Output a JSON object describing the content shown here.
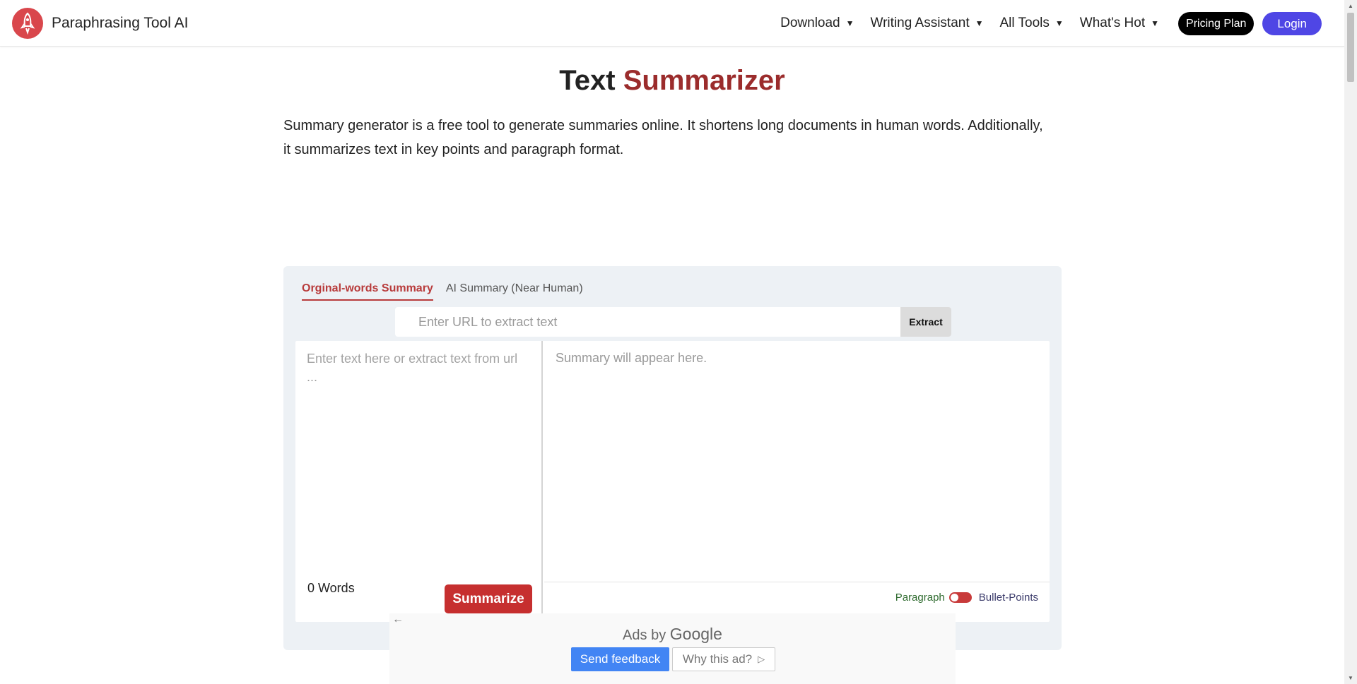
{
  "brand": {
    "name": "Paraphrasing Tool AI"
  },
  "nav": {
    "items": [
      {
        "label": "Download"
      },
      {
        "label": "Writing Assistant"
      },
      {
        "label": "All Tools"
      },
      {
        "label": "What's Hot"
      }
    ],
    "pricing_label": "Pricing Plan",
    "login_label": "Login"
  },
  "hero": {
    "title_part1": "Text",
    "title_part2": "Summarizer",
    "description": "Summary generator is a free tool to generate summaries online. It shortens long documents in human words. Additionally, it summarizes text in key points and paragraph format."
  },
  "tool": {
    "tabs": [
      {
        "label": "Orginal-words Summary",
        "active": true
      },
      {
        "label": "AI Summary (Near Human)",
        "active": false
      }
    ],
    "url_placeholder": "Enter URL to extract text",
    "extract_label": "Extract",
    "input_placeholder": "Enter text here or extract text from url ...",
    "word_count": "0 Words",
    "summarize_label": "Summarize",
    "output_placeholder": "Summary will appear here.",
    "format": {
      "paragraph_label": "Paragraph",
      "bullets_label": "Bullet-Points"
    }
  },
  "ad": {
    "ads_by": "Ads by",
    "google": "Google",
    "send_feedback": "Send feedback",
    "why_this_ad": "Why this ad?"
  },
  "colors": {
    "accent": "#9b2c2c",
    "summarize_button": "#c62f2f",
    "login_button": "#4f46e5",
    "pricing_button": "#000000",
    "card_background": "#edf1f5",
    "feedback_button": "#4285f4"
  }
}
